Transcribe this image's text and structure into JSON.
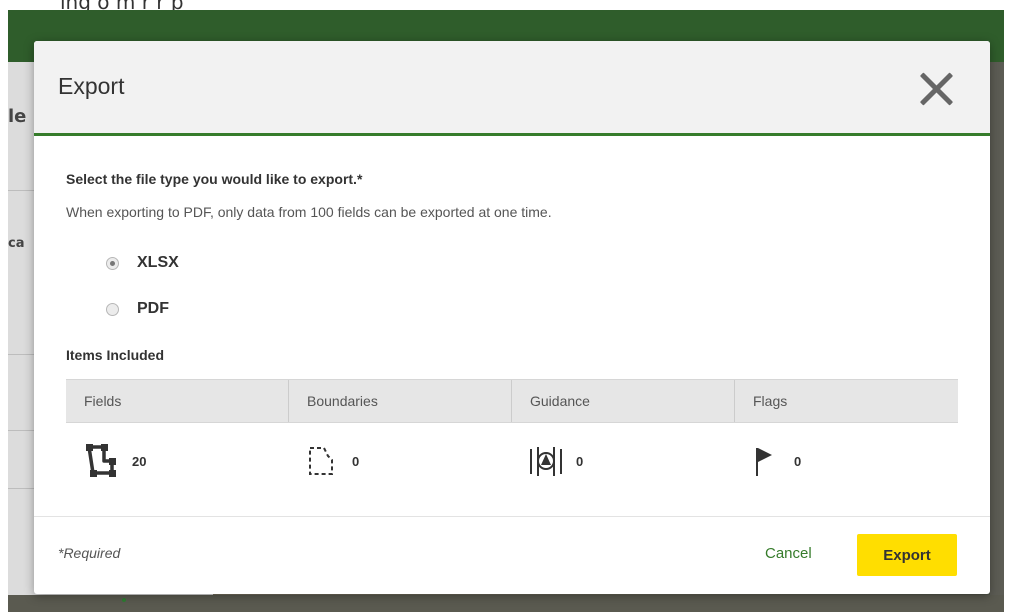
{
  "background": {
    "top_caption": "ing       o       m         r           r       p   "
  },
  "left_fragments": [
    "le",
    "ca"
  ],
  "modal": {
    "title": "Export",
    "close_icon": "close-x-icon",
    "prompt": "Select the file type you would like to export.*",
    "note": "When exporting to PDF, only data from 100 fields can be exported at one time.",
    "file_types": [
      {
        "label": "XLSX",
        "selected": true
      },
      {
        "label": "PDF",
        "selected": false
      }
    ],
    "items_heading": "Items Included",
    "items": [
      {
        "header": "Fields",
        "count": "20",
        "icon": "field-boundary-solid-icon"
      },
      {
        "header": "Boundaries",
        "count": "0",
        "icon": "boundary-dashed-icon"
      },
      {
        "header": "Guidance",
        "count": "0",
        "icon": "guidance-icon"
      },
      {
        "header": "Flags",
        "count": "0",
        "icon": "flag-icon"
      }
    ],
    "required_note": "*Required",
    "cancel_label": "Cancel",
    "export_label": "Export"
  },
  "colors": {
    "header_green": "#2f5d2b",
    "accent_green": "#367c2b",
    "export_yellow": "#ffde00"
  }
}
